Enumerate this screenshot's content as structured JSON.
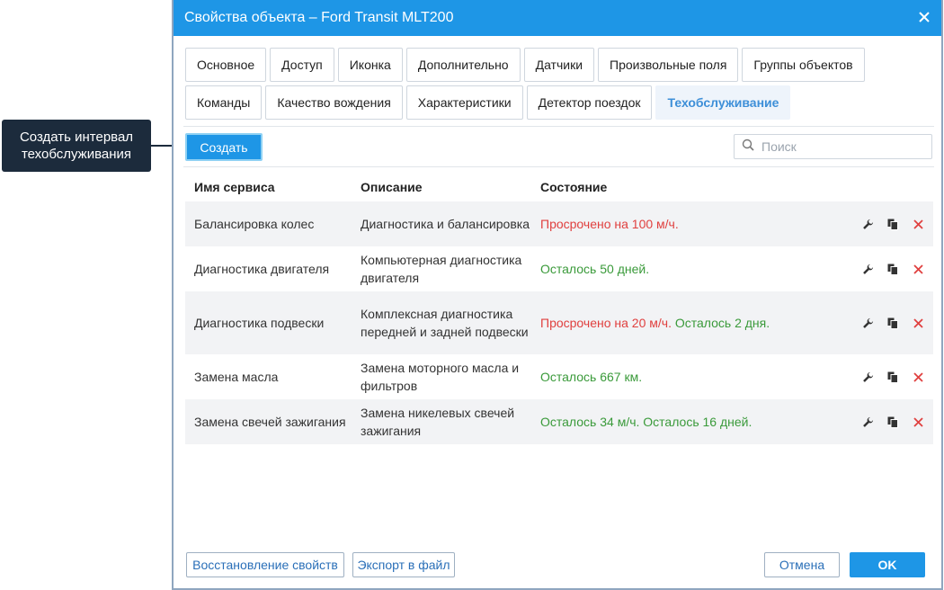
{
  "callout": {
    "line1": "Создать интервал",
    "line2": "техобслуживания"
  },
  "dialog": {
    "title": "Свойства объекта – Ford Transit MLT200"
  },
  "tabs": {
    "row1": [
      {
        "label": "Основное"
      },
      {
        "label": "Доступ"
      },
      {
        "label": "Иконка"
      },
      {
        "label": "Дополнительно"
      },
      {
        "label": "Датчики"
      },
      {
        "label": "Произвольные поля"
      },
      {
        "label": "Группы объектов"
      }
    ],
    "row2": [
      {
        "label": "Команды"
      },
      {
        "label": "Качество вождения"
      },
      {
        "label": "Характеристики"
      },
      {
        "label": "Детектор поездок"
      },
      {
        "label": "Техобслуживание"
      }
    ],
    "active": "Техобслуживание"
  },
  "toolbar": {
    "create_label": "Создать",
    "search_placeholder": "Поиск"
  },
  "table": {
    "headers": [
      "Имя сервиса",
      "Описание",
      "Состояние"
    ],
    "rows": [
      {
        "name": "Балансировка колес",
        "desc": "Диагностика и балансировка",
        "status_red": "Просрочено на 100 м/ч.",
        "status_green": ""
      },
      {
        "name": "Диагностика двигателя",
        "desc": "Компьютерная диагностика двигателя",
        "status_red": "",
        "status_green": "Осталось 50 дней."
      },
      {
        "name": "Диагностика подвески",
        "desc": "Комплексная диагностика передней и задней подвески",
        "status_red": "Просрочено на 20 м/ч.",
        "status_green": "Осталось 2 дня."
      },
      {
        "name": "Замена масла",
        "desc": "Замена моторного масла и фильтров",
        "status_red": "",
        "status_green": "Осталось 667 км."
      },
      {
        "name": "Замена свечей зажигания",
        "desc": "Замена никелевых свечей зажигания",
        "status_red": "",
        "status_green": "Осталось 34 м/ч. Осталось 16 дней."
      }
    ]
  },
  "footer": {
    "restore_label": "Восстановление свойств",
    "export_label": "Экспорт в файл",
    "cancel_label": "Отмена",
    "ok_label": "OK"
  },
  "colors": {
    "accent": "#1e96e6",
    "overdue": "#e0403f",
    "ok": "#3a9a3a",
    "callout_bg": "#1c2b3c"
  }
}
